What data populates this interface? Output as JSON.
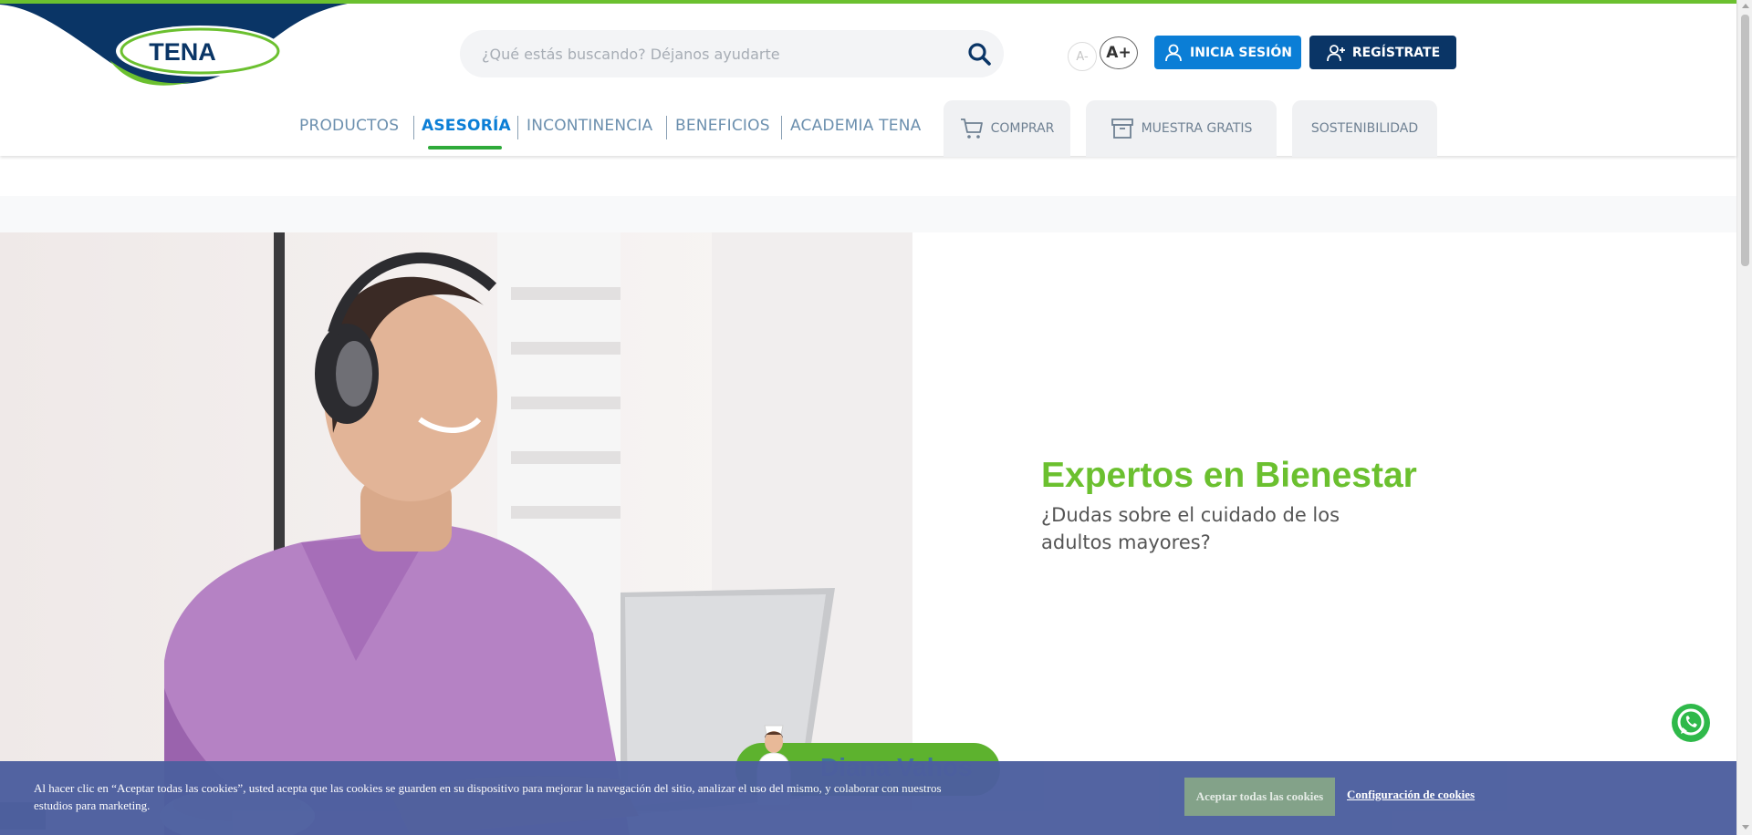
{
  "brand": {
    "logo_text": "TENA",
    "colors": {
      "green": "#6bc02f",
      "blue": "#0b7ed6",
      "navy": "#0a3566"
    }
  },
  "header": {
    "search": {
      "placeholder": "¿Qué estás buscando? Déjanos ayudarte",
      "value": "",
      "icon": "search-icon"
    },
    "font_decrease": "A-",
    "font_increase": "A+",
    "login_label": "INICIA SESIÓN",
    "register_label": "REGÍSTRATE"
  },
  "nav": {
    "items": [
      {
        "label": "PRODUCTOS",
        "active": false
      },
      {
        "label": "ASESORÍA",
        "active": true
      },
      {
        "label": "INCONTINENCIA",
        "active": false
      },
      {
        "label": "BENEFICIOS",
        "active": false
      },
      {
        "label": "ACADEMIA TENA",
        "active": false
      }
    ],
    "tabs": [
      {
        "label": "COMPRAR",
        "icon": "cart-icon"
      },
      {
        "label": "MUESTRA GRATIS",
        "icon": "box-icon"
      },
      {
        "label": "SOSTENIBILIDAD",
        "icon": ""
      }
    ]
  },
  "hero": {
    "title": "Expertos en Bienestar",
    "subtitle": "¿Dudas sobre el cuidado de los adultos mayores?"
  },
  "chat": {
    "name": "Diana Vahos"
  },
  "cookie": {
    "text": "Al hacer clic en “Aceptar todas las cookies”, usted acepta que las cookies se guarden en su dispositivo para mejorar la navegación del sitio, analizar el uso del mismo, y colaborar con nuestros estudios para marketing.",
    "accept_label": "Aceptar todas las cookies",
    "config_label": "Configuración de cookies"
  }
}
